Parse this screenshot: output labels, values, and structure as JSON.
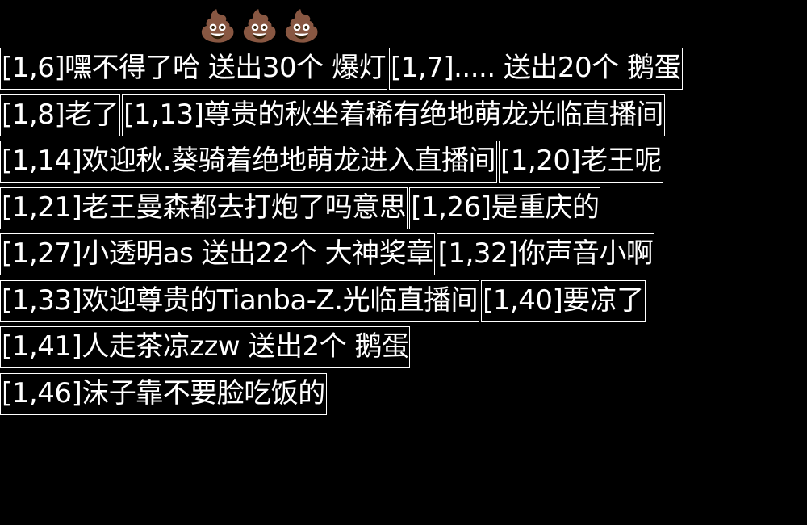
{
  "emojis": [
    "💩",
    "💩",
    "💩"
  ],
  "colors": {
    "background": "#000000",
    "text": "#ffffff",
    "border": "#ffffff"
  },
  "rows": [
    [
      "[1,6]嘿不得了哈 送出30个 爆灯",
      "[1,7]..... 送出20个 鹅蛋"
    ],
    [
      "[1,8]老了",
      "[1,13]尊贵的秋坐着稀有绝地萌龙光临直播间"
    ],
    [
      "[1,14]欢迎秋.葵骑着绝地萌龙进入直播间",
      "[1,20]老王呢"
    ],
    [
      "[1,21]老王曼森都去打炮了吗意思",
      "[1,26]是重庆的"
    ],
    [
      "[1,27]小透明as 送出22个 大神奖章",
      "[1,32]你声音小啊"
    ],
    [
      "[1,33]欢迎尊贵的Tianba-Z.光临直播间",
      "[1,40]要凉了"
    ],
    [
      "[1,41]人走茶凉zzw 送出2个 鹅蛋"
    ],
    [
      "[1,46]沫子靠不要脸吃饭的"
    ]
  ]
}
